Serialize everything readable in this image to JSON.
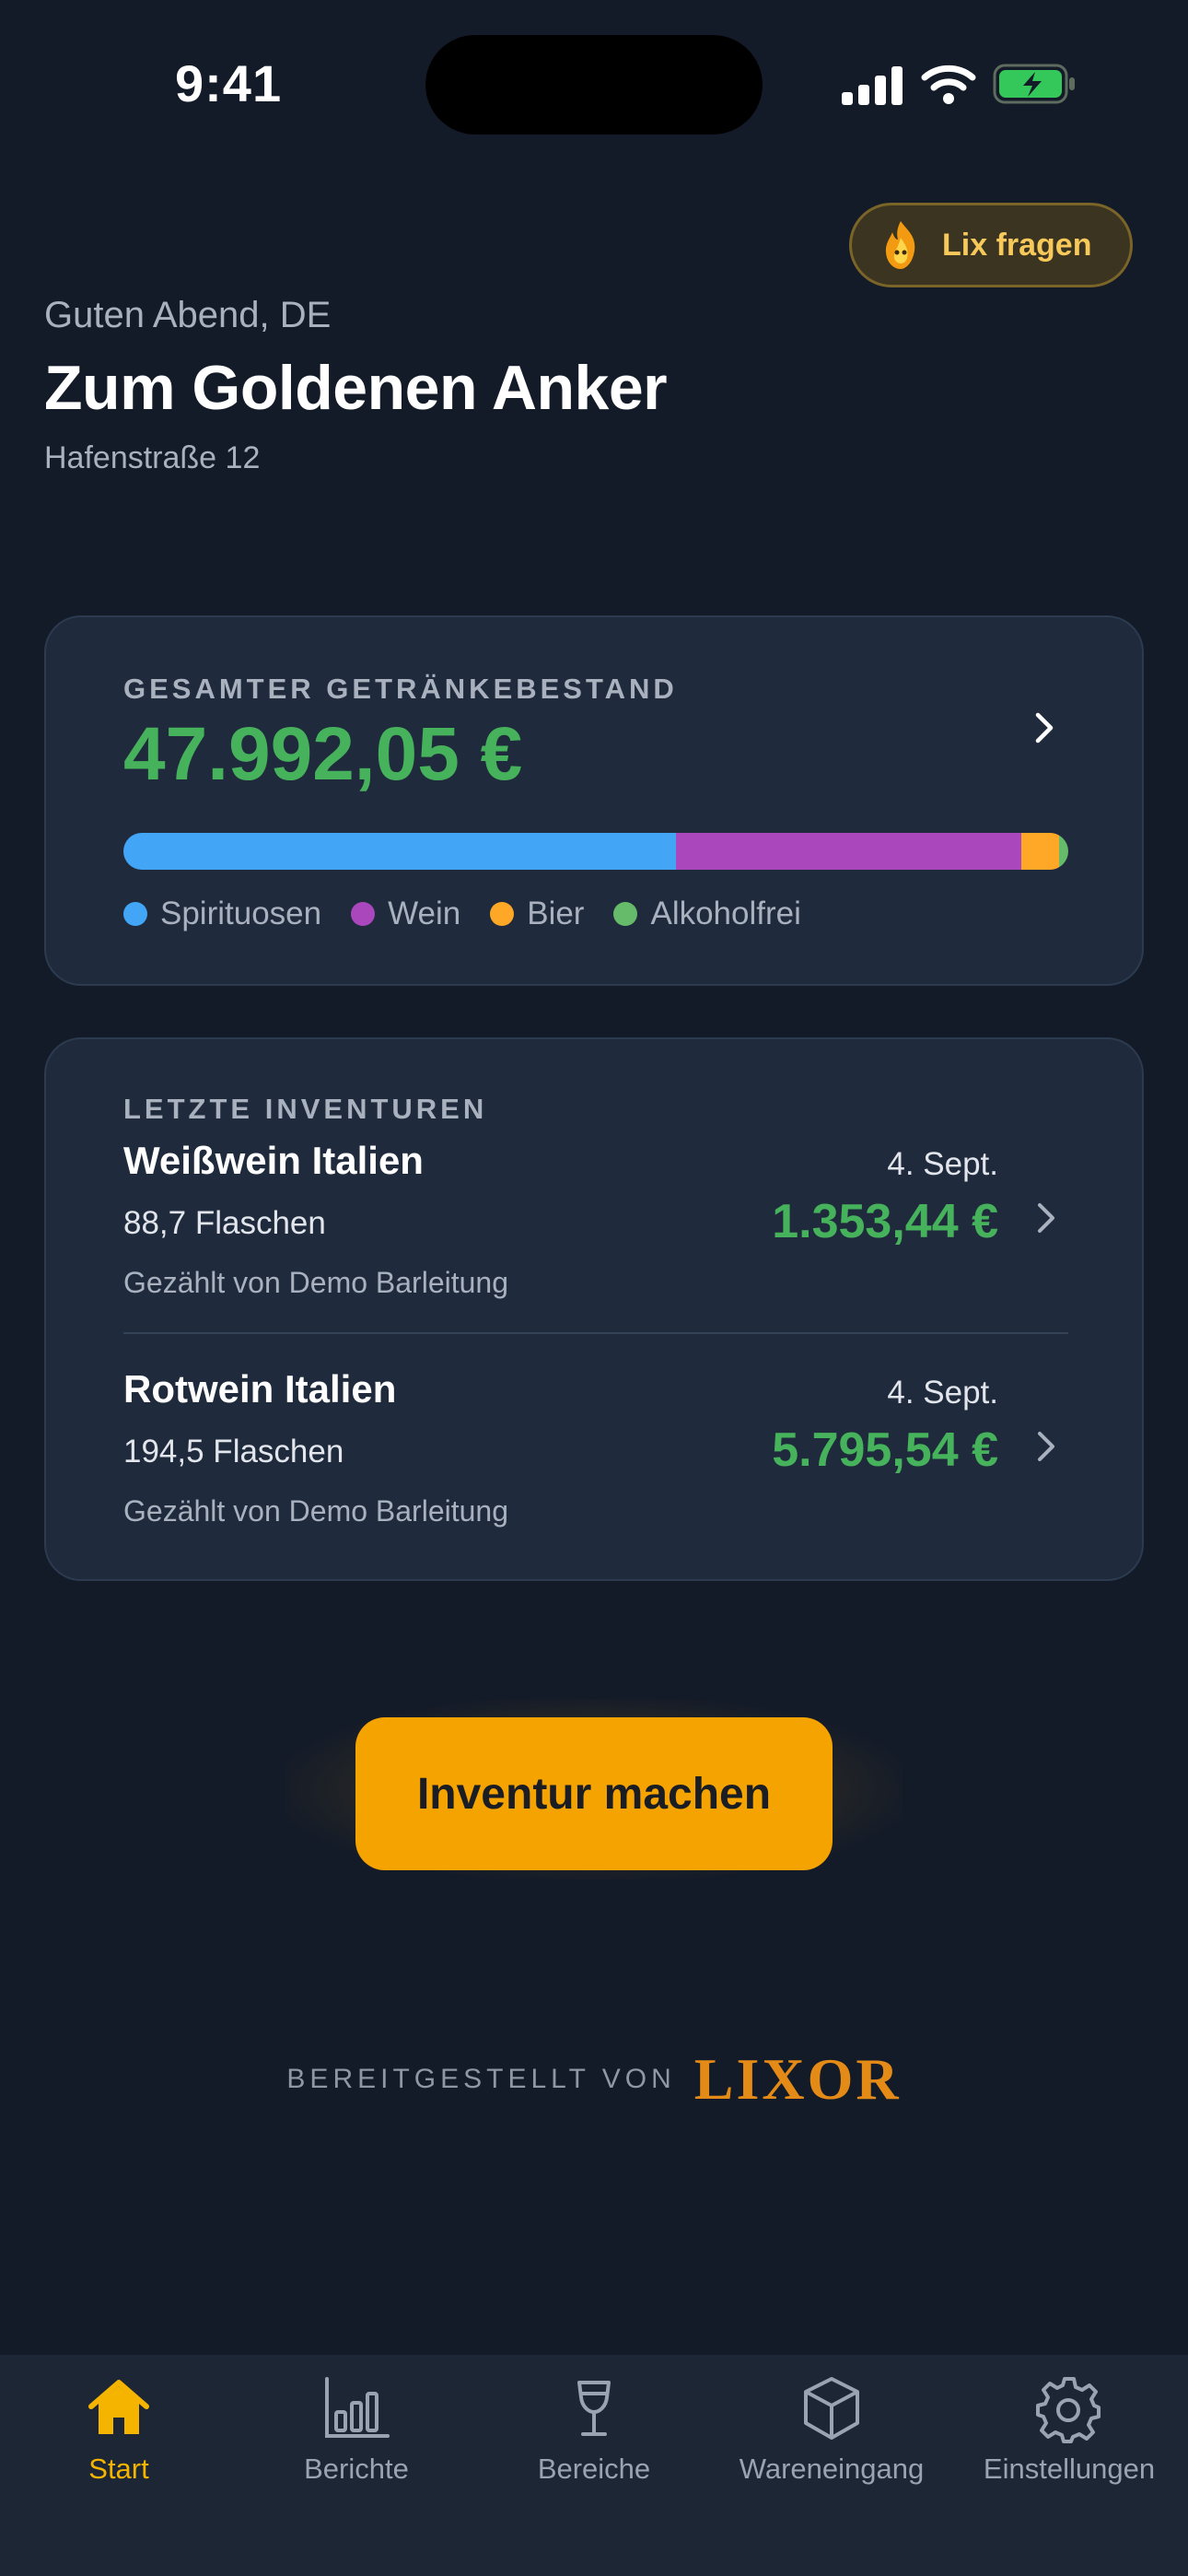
{
  "status_bar": {
    "time": "9:41"
  },
  "header": {
    "lix_button_label": "Lix fragen",
    "greeting": "Guten Abend, DE",
    "venue_name": "Zum Goldenen Anker",
    "address": "Hafenstraße 12"
  },
  "stock": {
    "caption": "GESAMTER GETRÄNKEBESTAND",
    "total": "47.992,05 €",
    "segments": [
      {
        "label": "Spirituosen",
        "color": "#42a5f5",
        "share": 0.585
      },
      {
        "label": "Wein",
        "color": "#ab47bc",
        "share": 0.365
      },
      {
        "label": "Bier",
        "color": "#ffa726",
        "share": 0.04
      },
      {
        "label": "Alkoholfrei",
        "color": "#66bb6a",
        "share": 0.01
      }
    ]
  },
  "inventories": {
    "caption": "LETZTE INVENTUREN",
    "items": [
      {
        "name": "Weißwein Italien",
        "date": "4. Sept.",
        "quantity": "88,7 Flaschen",
        "value": "1.353,44 €",
        "counted_by": "Gezählt von Demo Barleitung"
      },
      {
        "name": "Rotwein Italien",
        "date": "4. Sept.",
        "quantity": "194,5 Flaschen",
        "value": "5.795,54 €",
        "counted_by": "Gezählt von Demo Barleitung"
      }
    ]
  },
  "cta": {
    "label": "Inventur machen"
  },
  "footer": {
    "powered_by": "BEREITGESTELLT VON",
    "brand": "LIXOR"
  },
  "tabbar": {
    "active": "Start",
    "tabs": [
      {
        "label": "Start",
        "icon": "home-icon"
      },
      {
        "label": "Berichte",
        "icon": "bar-chart-icon"
      },
      {
        "label": "Bereiche",
        "icon": "wine-glass-icon"
      },
      {
        "label": "Wareneingang",
        "icon": "box-icon"
      },
      {
        "label": "Einstellungen",
        "icon": "gear-icon"
      }
    ]
  },
  "colors": {
    "accent": "#f5a300",
    "positive": "#47b25c",
    "background": "#141b28",
    "card": "#1f2b3c"
  }
}
